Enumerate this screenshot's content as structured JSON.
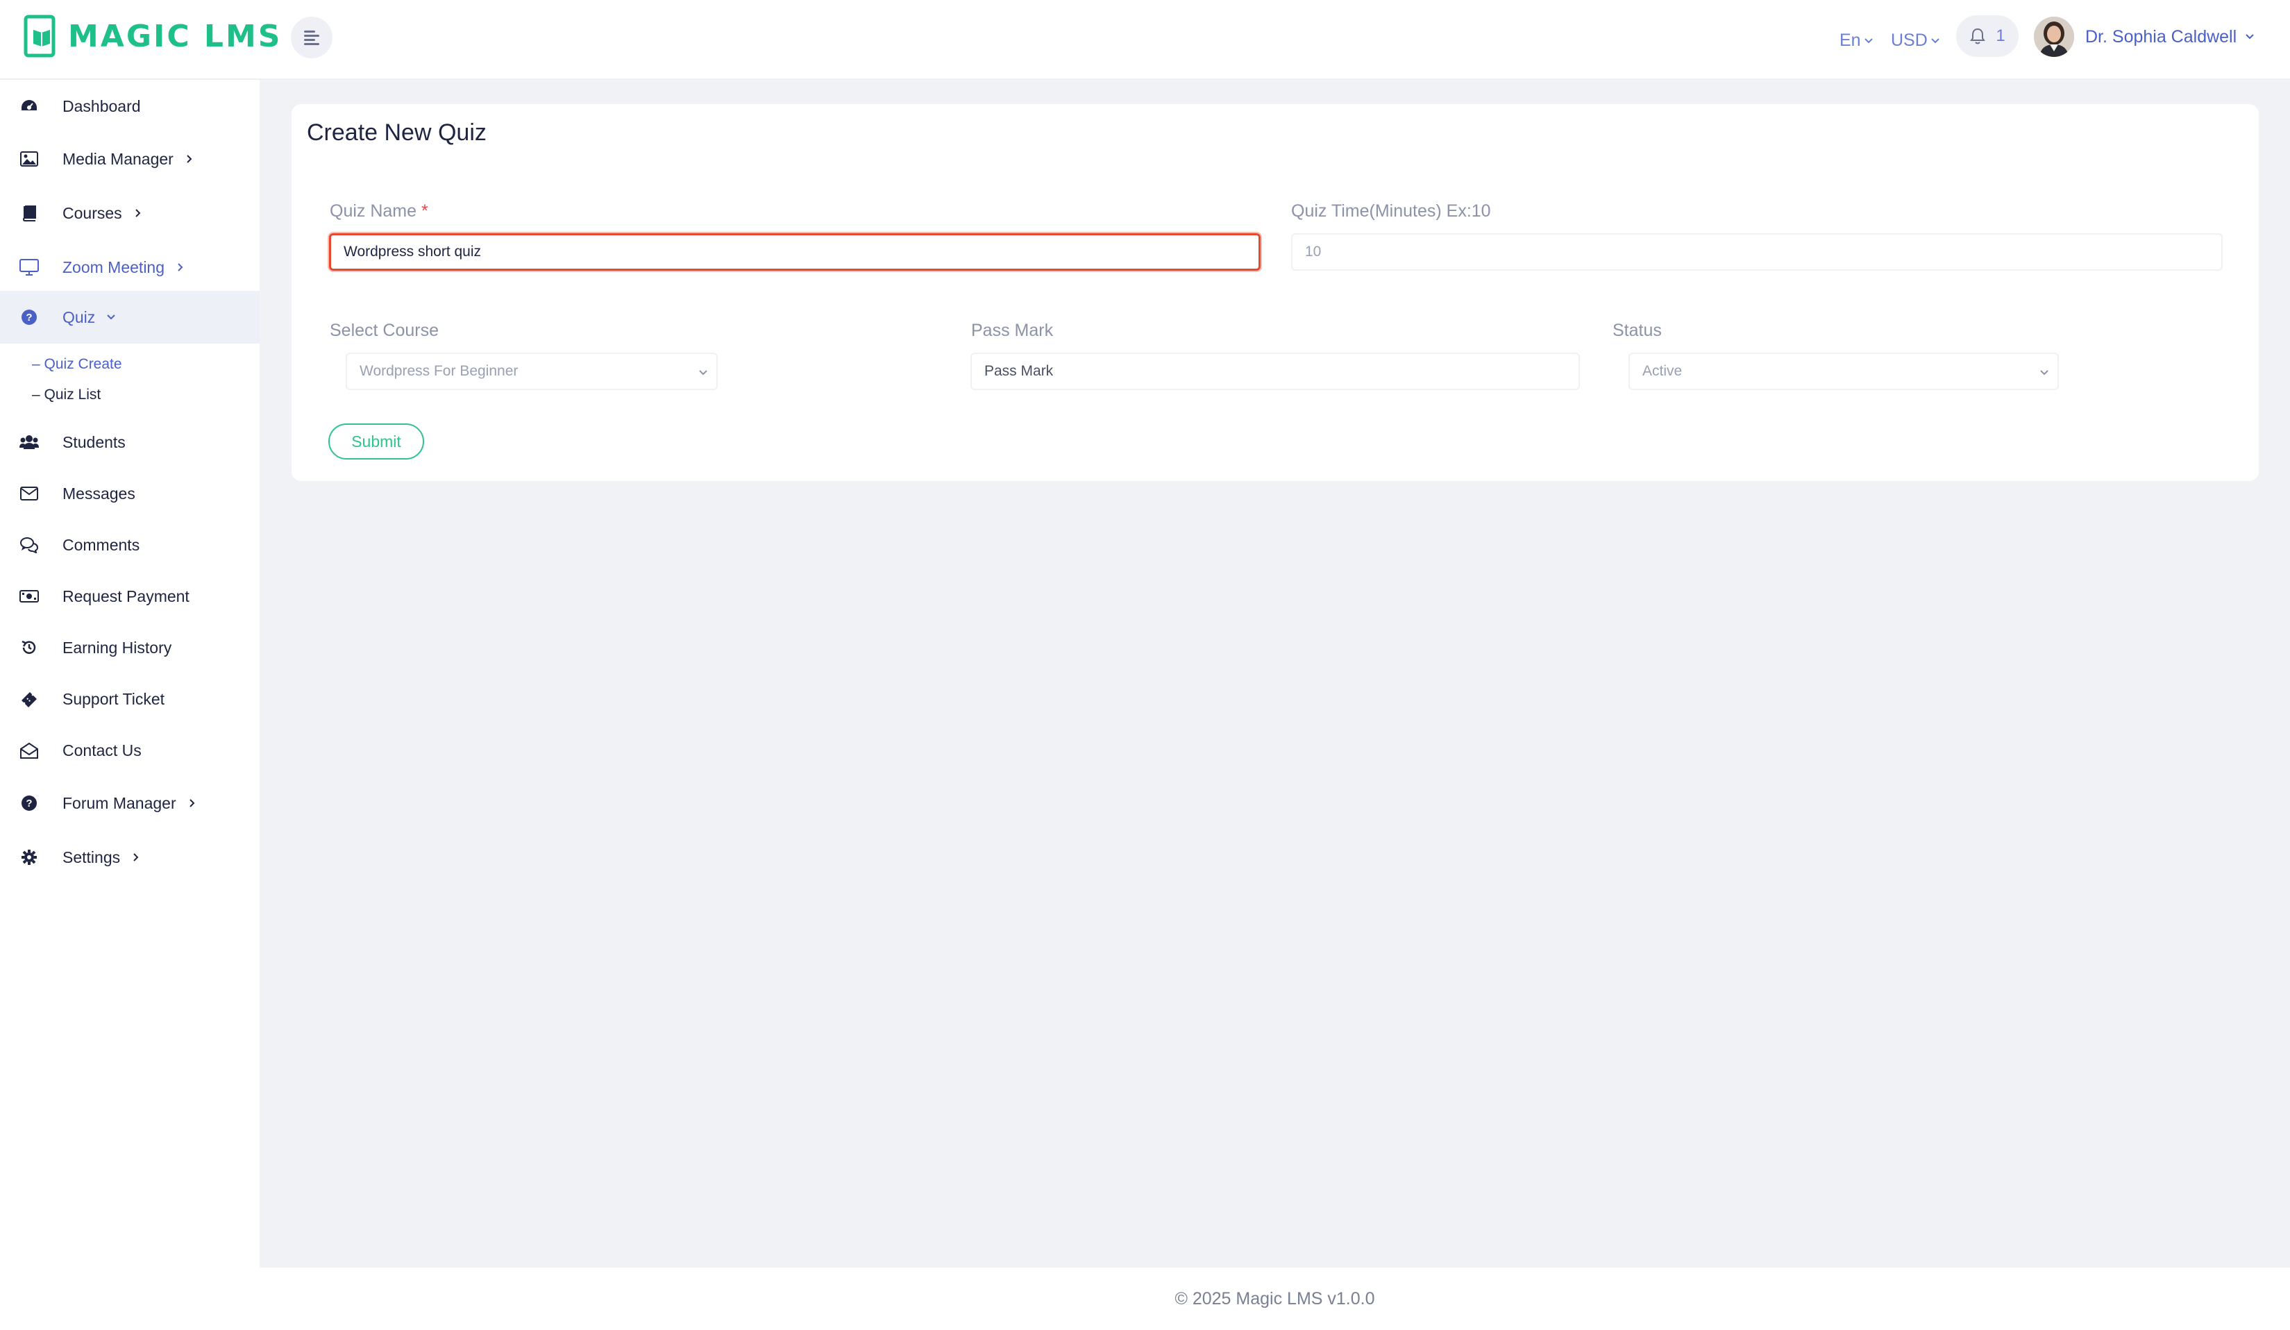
{
  "brand": {
    "logo_text": "MAGIC LMS",
    "accent": "#1fbf8a"
  },
  "header": {
    "language": "En",
    "currency": "USD",
    "notification_count": "1",
    "user_name": "Dr. Sophia Caldwell"
  },
  "sidebar": {
    "items": [
      {
        "label": "Dashboard",
        "icon": "dashboard-icon"
      },
      {
        "label": "Media Manager",
        "icon": "image-icon",
        "has_submenu": true
      },
      {
        "label": "Courses",
        "icon": "book-icon",
        "has_submenu": true
      },
      {
        "label": "Zoom Meeting",
        "icon": "monitor-icon",
        "has_submenu": true
      },
      {
        "label": "Quiz",
        "icon": "question-icon",
        "expanded": true
      },
      {
        "label": "Students",
        "icon": "users-icon"
      },
      {
        "label": "Messages",
        "icon": "envelope-icon"
      },
      {
        "label": "Comments",
        "icon": "comments-icon"
      },
      {
        "label": "Request Payment",
        "icon": "money-icon"
      },
      {
        "label": "Earning History",
        "icon": "history-icon"
      },
      {
        "label": "Support Ticket",
        "icon": "ticket-icon"
      },
      {
        "label": "Contact Us",
        "icon": "envelope-open-icon"
      },
      {
        "label": "Forum Manager",
        "icon": "question-icon",
        "has_submenu": true
      },
      {
        "label": "Settings",
        "icon": "gear-icon",
        "has_submenu": true
      }
    ],
    "quiz_sub": [
      {
        "label": "– Quiz Create",
        "active": true
      },
      {
        "label": "– Quiz List",
        "active": false
      }
    ]
  },
  "form": {
    "title": "Create New Quiz",
    "quiz_name_label": "Quiz Name",
    "required_mark": "*",
    "quiz_name_value": "Wordpress short quiz",
    "quiz_time_label": "Quiz Time(Minutes) Ex:10",
    "quiz_time_value": "10",
    "course_label": "Select Course",
    "course_value": "Wordpress For Beginner",
    "pass_mark_label": "Pass Mark",
    "pass_mark_placeholder": "Pass Mark",
    "status_label": "Status",
    "status_value": "Active",
    "submit_label": "Submit"
  },
  "footer": {
    "text": "© 2025 Magic LMS v1.0.0"
  }
}
